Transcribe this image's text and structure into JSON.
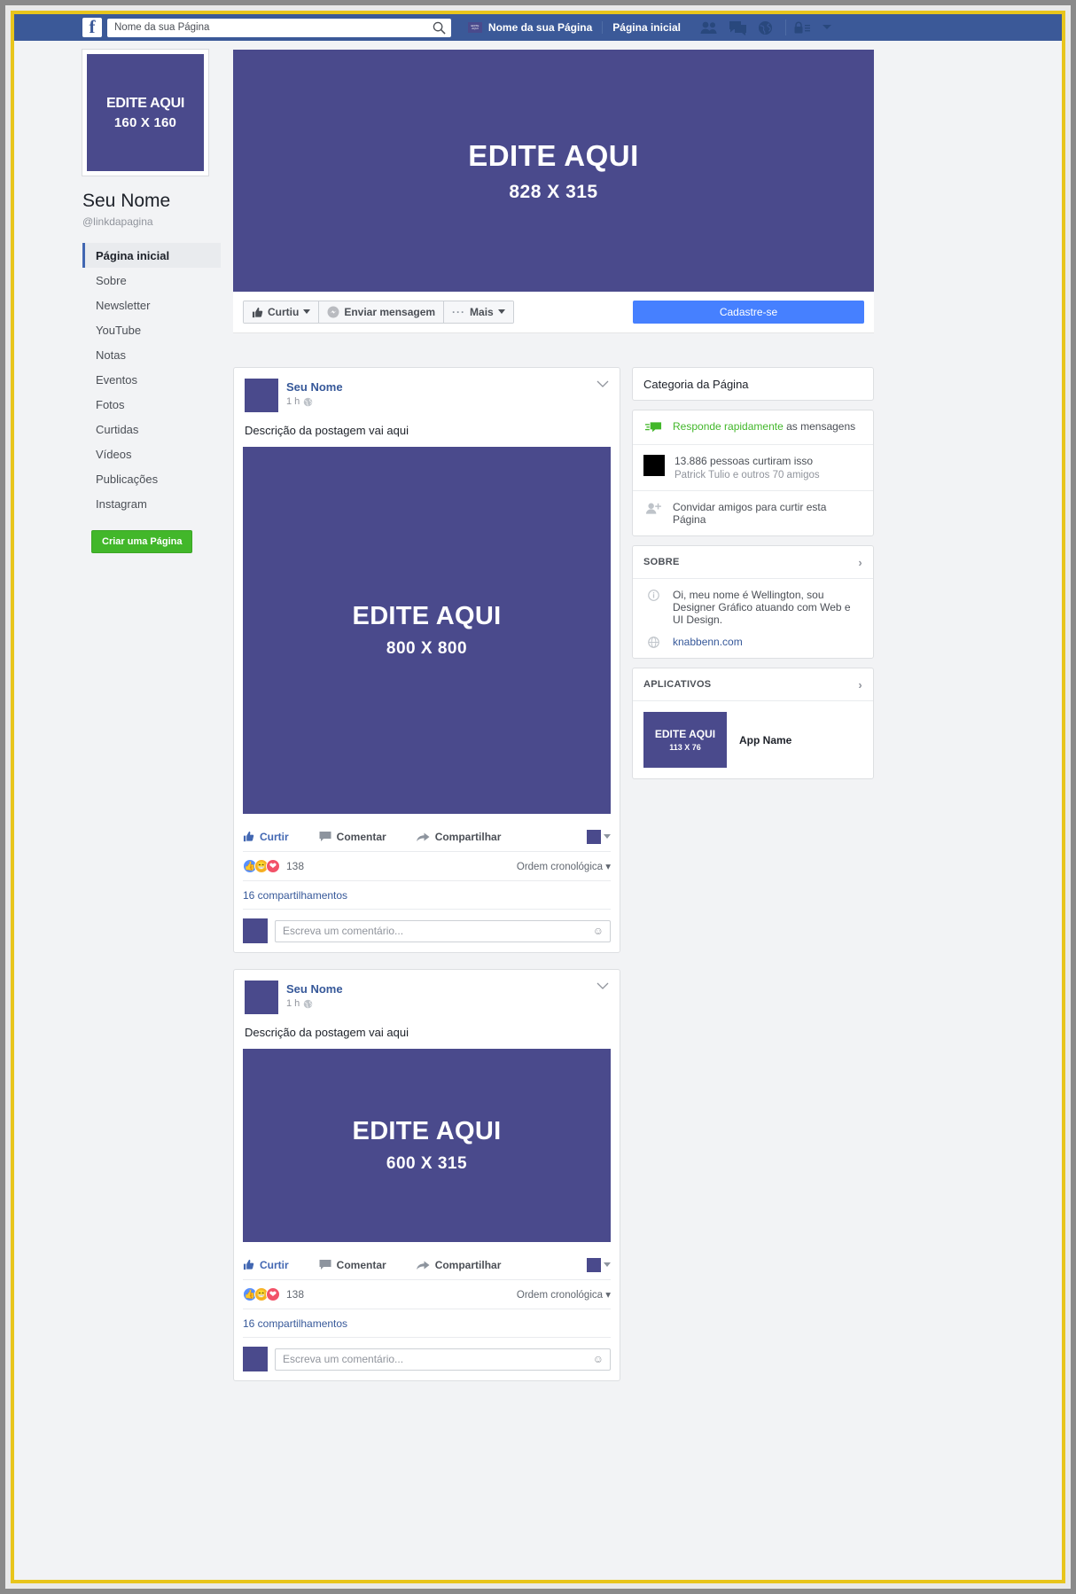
{
  "topbar": {
    "search_value": "Nome da sua Página",
    "search_placeholder": "Nome da sua Página",
    "page_name": "Nome da sua Página",
    "home_label": "Página inicial",
    "thumb_text": "EDITE AQUI",
    "icons": [
      "friends-icon",
      "messages-icon",
      "globe-icon",
      "privacy-lock-icon",
      "chevron-down-icon"
    ]
  },
  "profile": {
    "avatar_line1": "EDITE AQUI",
    "avatar_line2": "160 X 160",
    "name": "Seu Nome",
    "handle": "@linkdapagina"
  },
  "nav": {
    "items": [
      {
        "label": "Página inicial",
        "active": true
      },
      {
        "label": "Sobre",
        "active": false
      },
      {
        "label": "Newsletter",
        "active": false
      },
      {
        "label": "YouTube",
        "active": false
      },
      {
        "label": "Notas",
        "active": false
      },
      {
        "label": "Eventos",
        "active": false
      },
      {
        "label": "Fotos",
        "active": false
      },
      {
        "label": "Curtidas",
        "active": false
      },
      {
        "label": "Vídeos",
        "active": false
      },
      {
        "label": "Publicações",
        "active": false
      },
      {
        "label": "Instagram",
        "active": false
      }
    ],
    "create_button": "Criar uma Página"
  },
  "cover": {
    "line1": "EDITE AQUI",
    "line2": "828 X 315"
  },
  "actions": {
    "like": "Curtiu",
    "message": "Enviar mensagem",
    "more": "Mais",
    "signup": "Cadastre-se"
  },
  "posts": [
    {
      "author": "Seu Nome",
      "time": "1 h",
      "text": "Descrição da postagem vai aqui",
      "image_line1": "EDITE AQUI",
      "image_line2": "800 X 800",
      "like": "Curtir",
      "comment": "Comentar",
      "share": "Compartilhar",
      "reaction_count": "138",
      "order_label": "Ordem cronológica",
      "shares": "16 compartilhamentos",
      "comment_placeholder": "Escreva um comentário..."
    },
    {
      "author": "Seu Nome",
      "time": "1 h",
      "text": "Descrição da postagem vai aqui",
      "image_line1": "EDITE AQUI",
      "image_line2": "600 X 315",
      "like": "Curtir",
      "comment": "Comentar",
      "share": "Compartilhar",
      "reaction_count": "138",
      "order_label": "Ordem cronológica",
      "shares": "16 compartilhamentos",
      "comment_placeholder": "Escreva um comentário..."
    }
  ],
  "sidebar": {
    "category_title": "Categoria da Página",
    "responds_link": "Responde rapidamente",
    "responds_rest": " as mensagens",
    "likes_count": "13.886 pessoas curtiram isso",
    "likes_friends": "Patrick Tulio e outros 70 amigos",
    "invite": "Convidar amigos para curtir esta Página",
    "about_title": "SOBRE",
    "about_text": "Oi, meu nome é Wellington, sou Designer Gráfico atuando com Web e UI Design.",
    "about_link": "knabbenn.com",
    "apps_title": "APLICATIVOS",
    "app_thumb_line1": "EDITE AQUI",
    "app_thumb_line2": "113 X 76",
    "app_name": "App Name"
  },
  "colors": {
    "fb_blue": "#3b5998",
    "placeholder_purple": "#4a4a8c",
    "green": "#42b72a",
    "signup_blue": "#4680ff"
  }
}
